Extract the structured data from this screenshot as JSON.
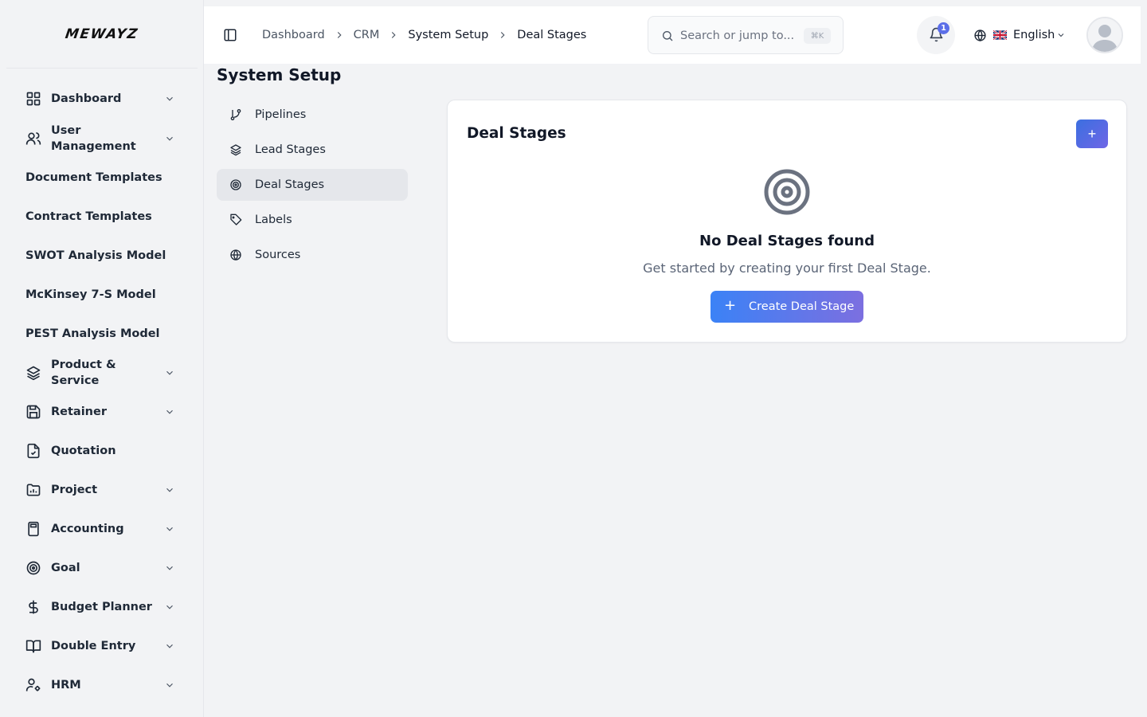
{
  "brand": {
    "logo": "MEWAYZ"
  },
  "sidebar": {
    "items": [
      {
        "label": "Dashboard",
        "icon": "grid-icon",
        "expandable": true
      },
      {
        "label": "User Management",
        "icon": "users-icon",
        "expandable": true
      },
      {
        "label": "Document Templates",
        "icon": "",
        "expandable": false
      },
      {
        "label": "Contract Templates",
        "icon": "",
        "expandable": false
      },
      {
        "label": "SWOT Analysis Model",
        "icon": "",
        "expandable": false
      },
      {
        "label": "McKinsey 7-S Model",
        "icon": "",
        "expandable": false
      },
      {
        "label": "PEST Analysis Model",
        "icon": "",
        "expandable": false
      },
      {
        "label": "Product & Service",
        "icon": "layers-icon",
        "expandable": true
      },
      {
        "label": "Retainer",
        "icon": "save-icon",
        "expandable": true
      },
      {
        "label": "Quotation",
        "icon": "file-check-icon",
        "expandable": false
      },
      {
        "label": "Project",
        "icon": "folder-chart-icon",
        "expandable": true
      },
      {
        "label": "Accounting",
        "icon": "calculator-icon",
        "expandable": true
      },
      {
        "label": "Goal",
        "icon": "target-icon",
        "expandable": true
      },
      {
        "label": "Budget Planner",
        "icon": "dollar-icon",
        "expandable": true
      },
      {
        "label": "Double Entry",
        "icon": "book-open-icon",
        "expandable": true
      },
      {
        "label": "HRM",
        "icon": "user-cog-icon",
        "expandable": true
      }
    ]
  },
  "topbar": {
    "breadcrumbs": [
      "Dashboard",
      "CRM",
      "System Setup",
      "Deal Stages"
    ],
    "search_placeholder": "Search or jump to...",
    "search_shortcut": "⌘K",
    "notification_count": "1",
    "language": "English"
  },
  "page": {
    "title": "System Setup",
    "sub_nav": [
      {
        "label": "Pipelines",
        "icon": "git-branch-icon",
        "active": false
      },
      {
        "label": "Lead Stages",
        "icon": "layers-icon",
        "active": false
      },
      {
        "label": "Deal Stages",
        "icon": "target-icon",
        "active": true
      },
      {
        "label": "Labels",
        "icon": "tag-icon",
        "active": false
      },
      {
        "label": "Sources",
        "icon": "globe-icon",
        "active": false
      }
    ],
    "card": {
      "title": "Deal Stages",
      "add_label": "+",
      "empty_title": "No Deal Stages found",
      "empty_subtitle": "Get started by creating your first Deal Stage.",
      "create_plus": "+",
      "create_label": "Create Deal Stage"
    }
  },
  "colors": {
    "accent_start": "#3b82f6",
    "accent_end": "#7c6fe0",
    "badge": "#5b6ee8"
  }
}
